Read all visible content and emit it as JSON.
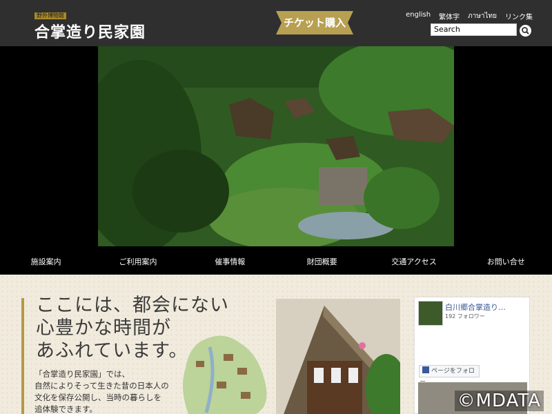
{
  "header": {
    "logo_badge": "野外博物館",
    "logo_text": "合掌造り民家園",
    "ticket_label": "チケット購入",
    "languages": [
      "english",
      "繁体字",
      "ภาษาไทย",
      "リンク集"
    ],
    "search_placeholder": "Search"
  },
  "nav": {
    "items": [
      "施設案内",
      "ご利用案内",
      "催事情報",
      "財団概要",
      "交通アクセス",
      "お問い合せ"
    ]
  },
  "content": {
    "headline": "ここには、都会にない\n心豊かな時間が\nあふれています。",
    "body": "「合掌造り民家園」では、\n自然によりそって生きた昔の日本人の\n文化を保存公開し、当時の暮らしを\n追体験できます。"
  },
  "facebook": {
    "page_name": "白川郷合掌造り…",
    "followers": "192 フォロワー",
    "follow_label": "ページをフォロー"
  },
  "watermark": "©MDATA",
  "colors": {
    "header_bg": "#2f2f2f",
    "accent_gold": "#b49a44",
    "content_bg": "#f1ebde"
  }
}
